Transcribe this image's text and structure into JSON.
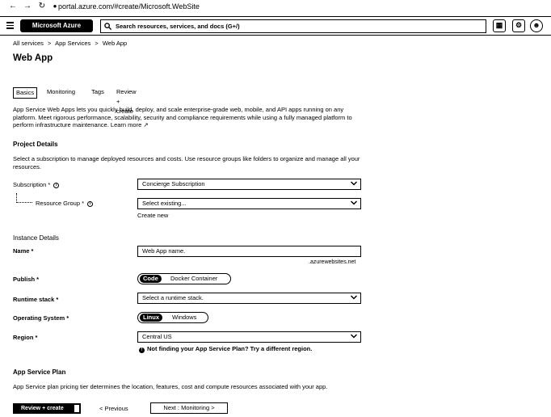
{
  "browser": {
    "url": "portal.azure.com/#create/Microsoft.WebSite"
  },
  "header": {
    "logo": "Microsoft Azure",
    "search_placeholder": "Search resources, services, and docs (G+/)"
  },
  "breadcrumb": [
    "All services",
    ">",
    "App Services",
    ">",
    "Web App"
  ],
  "page": {
    "title": "Web App"
  },
  "tabs": [
    {
      "label": "Basics",
      "active": true
    },
    {
      "label": "Monitoring"
    },
    {
      "label": "Tags"
    },
    {
      "label": "Review + create"
    }
  ],
  "intro": {
    "text": "App Service Web Apps lets you quickly build, deploy, and scale enterprise-grade web, mobile, and API apps running on any platform. Meet rigorous performance, scalability, security and compliance requirements while using a fully managed platform to perform infrastructure maintenance.",
    "learn_more": "Learn more"
  },
  "project": {
    "title": "Project Details",
    "desc": "Select a subscription to manage deployed resources and costs. Use resource groups like folders to organize and manage all your resources.",
    "subscription_label": "Subscription *",
    "subscription_value": "Concierge Subscription",
    "rg_label": "Resource Group *",
    "rg_value": "Select existing...",
    "create_new": "Create new"
  },
  "instance": {
    "title": "Instance Details",
    "name_label": "Name *",
    "name_placeholder": "Web App name.",
    "name_suffix": ".azurewebsites.net",
    "publish_label": "Publish *",
    "publish_options": [
      "Code",
      "Docker Container"
    ],
    "runtime_label": "Runtime stack *",
    "runtime_value": "Select a runtime stack.",
    "os_label": "Operating System *",
    "os_options": [
      "Linux",
      "Windows"
    ],
    "region_label": "Region *",
    "region_value": "Central US",
    "region_note": "Not finding your App Service Plan? Try a different region."
  },
  "plan": {
    "title": "App Service Plan",
    "desc": "App Service plan pricing tier determines the location, features, cost and compute resources associated with your app."
  },
  "footer": {
    "review": "Review + create",
    "previous": "< Previous",
    "next": "Next : Monitoring >"
  }
}
